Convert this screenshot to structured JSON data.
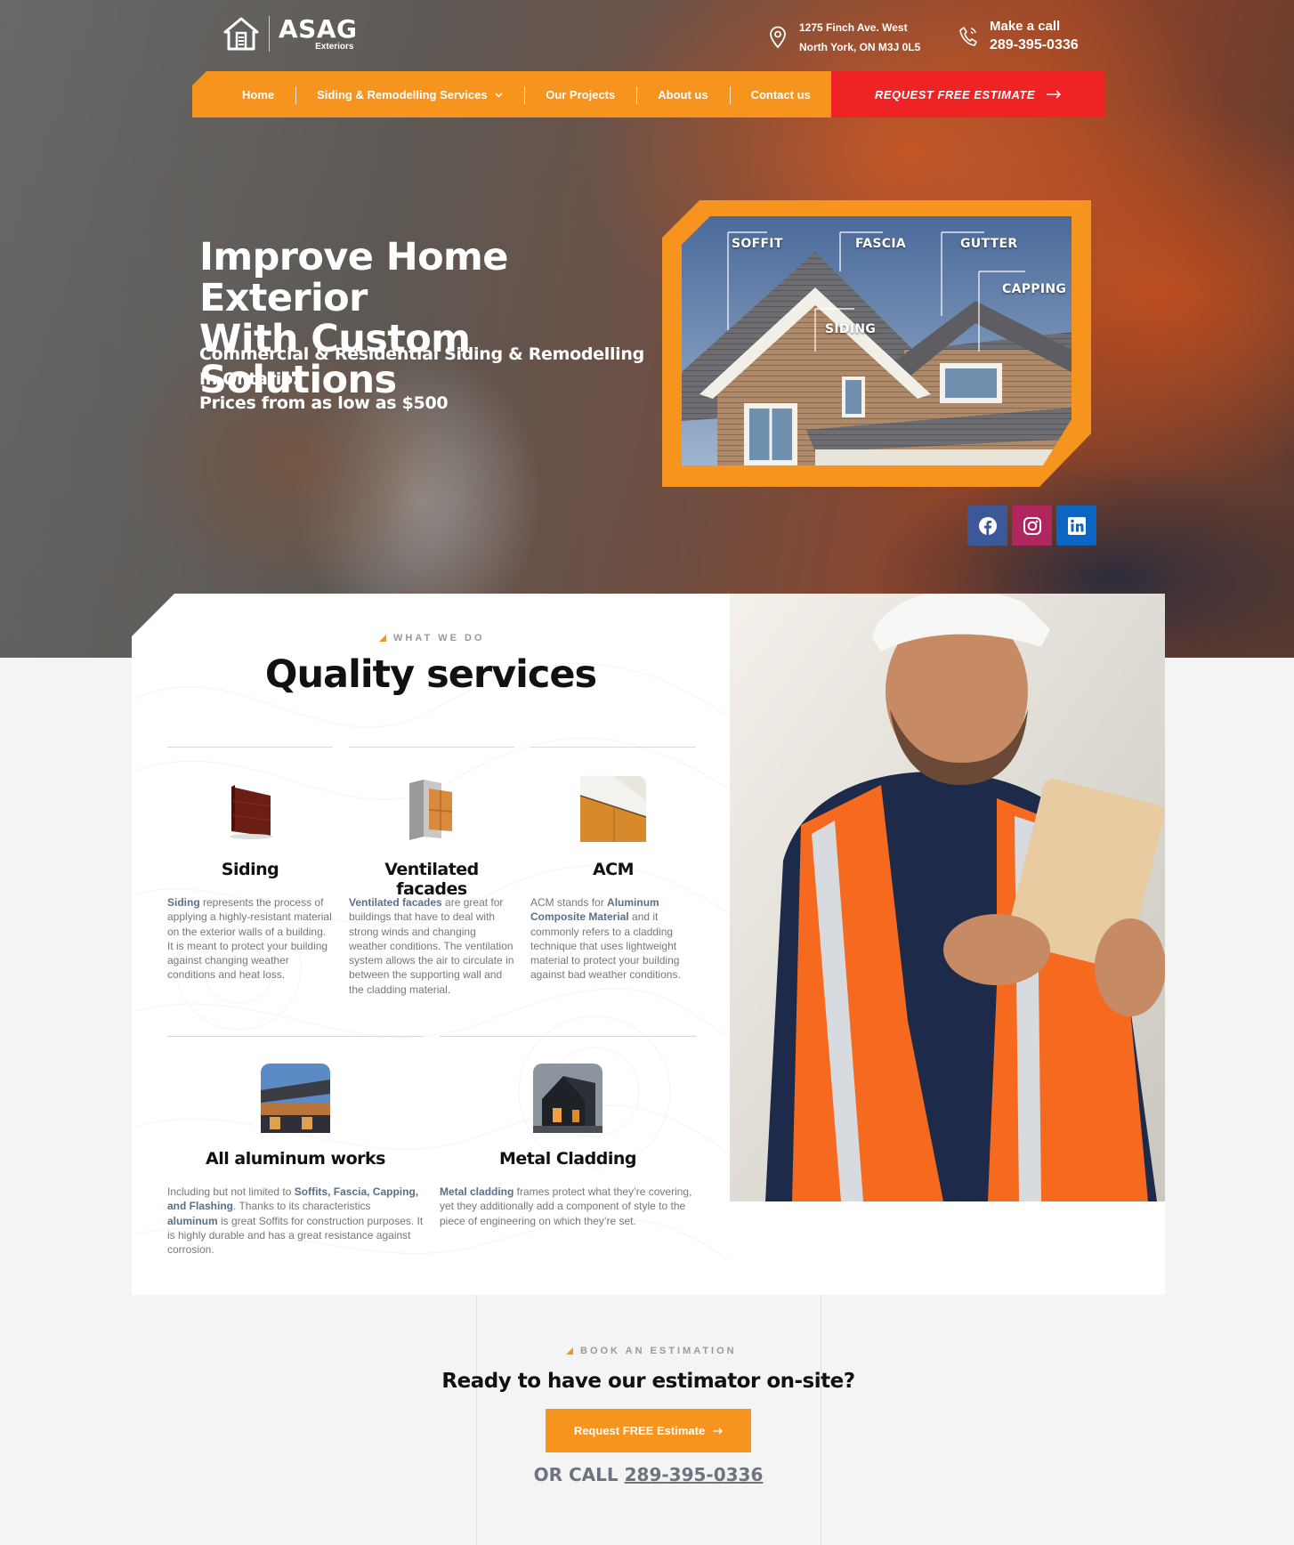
{
  "brand": {
    "name": "ASAG",
    "sub": "Exteriors"
  },
  "address": {
    "line1": "1275 Finch Ave. West",
    "line2": "North York, ON M3J 0L5"
  },
  "call": {
    "label": "Make a call",
    "phone": "289-395-0336"
  },
  "nav": {
    "items": [
      "Home",
      "Siding & Remodelling Services",
      "Our Projects",
      "About us",
      "Contact us"
    ],
    "cta": "REQUEST FREE ESTIMATE"
  },
  "hero": {
    "title_line1": "Improve Home Exterior",
    "title_line2": "With Custom Solutions",
    "subtitle": "Commercial & Residential Siding & Remodelling In Ontario.",
    "price": "Prices from as low as $500",
    "house_labels": [
      "SOFFIT",
      "FASCIA",
      "GUTTER",
      "CAPPING",
      "SIDING"
    ]
  },
  "socials": [
    "facebook-icon",
    "instagram-icon",
    "linkedin-icon"
  ],
  "services": {
    "eyebrow": "WHAT WE DO",
    "title": "Quality services",
    "items": [
      {
        "name": "Siding",
        "lead": "Siding",
        "desc": " represents the process of applying a highly-resistant material on the exterior walls of a building. It is meant to protect your building against changing weather conditions and heat loss."
      },
      {
        "name": "Ventilated facades",
        "lead": "Ventilated facades",
        "desc": " are great for buildings that have to deal with strong winds and changing weather conditions. The ventilation system allows the air to circulate in between the supporting wall and the cladding material."
      },
      {
        "name": "ACM",
        "pre": "ACM stands for ",
        "lead": "Aluminum Composite Material",
        "desc": " and it commonly refers to a cladding technique that uses lightweight material to protect your building against bad weather conditions."
      },
      {
        "name": "All aluminum works",
        "pre": "Including but not limited to ",
        "lead": "Soffits, Fascia, Capping, and Flashing",
        "mid": ". Thanks to its characteristics ",
        "lead2": "aluminum",
        "desc": " is great Soffits for construction purposes. It is highly durable and has a great resistance against corrosion."
      },
      {
        "name": "Metal Cladding",
        "lead": "Metal cladding",
        "desc": " frames protect what they’re covering, yet they additionally add a component of style to the piece of engineering on which they’re set."
      }
    ]
  },
  "cta": {
    "eyebrow": "BOOK AN ESTIMATION",
    "title": "Ready to have our estimator on-site?",
    "button": "Request FREE Estimate",
    "call_prefix": "OR CALL",
    "phone": "289-395-0336"
  },
  "colors": {
    "accent": "#f7941d",
    "cta_red": "#ef2323",
    "link": "#5a6f8a"
  }
}
